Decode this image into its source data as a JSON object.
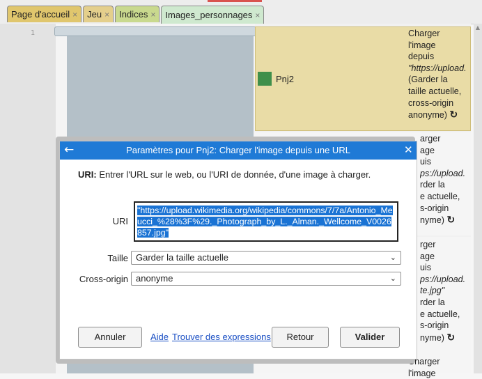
{
  "tabs": [
    {
      "label": "Page d'accueil",
      "close": "×"
    },
    {
      "label": "Jeu",
      "close": "×"
    },
    {
      "label": "Indices",
      "close": "×"
    },
    {
      "label": "Images_personnages",
      "close": "×"
    }
  ],
  "editor": {
    "line_number": "1"
  },
  "cards": {
    "pnj_label": "Pnj2",
    "swatch_color": "#3f8f4a",
    "card1": [
      "Charger",
      "l'image",
      "depuis",
      "\"https://upload.",
      "(Garder la",
      "taille actuelle,",
      "cross-origin",
      "anonyme)"
    ],
    "card2": [
      "arger",
      "age",
      "uis",
      "ps://upload.",
      "rder la",
      "e actuelle,",
      "s-origin",
      "nyme)"
    ],
    "card3": [
      "rger",
      "age",
      "uis",
      "ps://upload.",
      "te.jpg\"",
      "rder la",
      "e actuelle,",
      "s-origin",
      "nyme)"
    ],
    "card4": [
      "Charger",
      "l'image"
    ],
    "reload_glyph": "↻"
  },
  "dialog": {
    "back_glyph": "←",
    "title": "Paramètres pour Pnj2: Charger l'image depuis une URL",
    "close_glyph": "✕",
    "help_bold": "URI:",
    "help_text": " Entrer l'URL sur le web, ou l'URI de donnée, d'une image à charger.",
    "uri_label": "URI",
    "uri_value": "\"https://upload.wikimedia.org/wikipedia/commons/7/7a/Antonio_Meucci_%28%3F%29._Photograph_by_L._Alman._Wellcome_V0026857.jpg\"",
    "size_label": "Taille",
    "size_value": "Garder la taille actuelle",
    "cors_label": "Cross-origin",
    "cors_value": "anonyme",
    "chevron": "⌄",
    "cancel": "Annuler",
    "help_link": "Aide",
    "expressions_link": "Trouver des expressions",
    "back": "Retour",
    "validate": "Valider"
  }
}
